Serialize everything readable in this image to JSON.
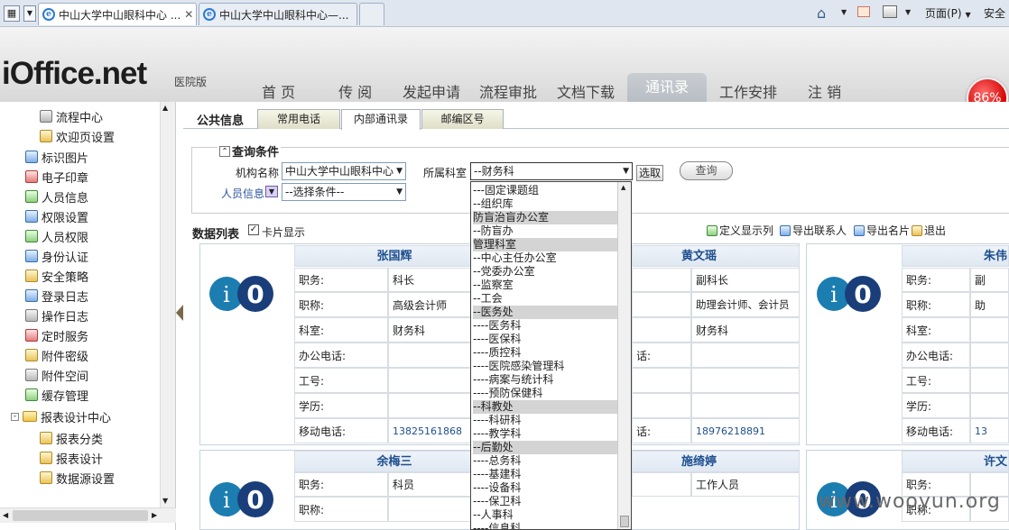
{
  "browser": {
    "tabs": [
      {
        "title": "中山大学中山眼科中心 ...",
        "close": "✕"
      },
      {
        "title": "中山大学中山眼科中心—..."
      }
    ],
    "commands": {
      "page": "页面(P)",
      "safety": "安全"
    },
    "icons": [
      "home-icon",
      "feed-icon",
      "mail-icon",
      "print-icon"
    ]
  },
  "app": {
    "logo": "iOffice.net",
    "edition": "医院版",
    "nav": [
      "首 页",
      "传 阅",
      "发起申请",
      "流程审批",
      "文档下载",
      "通讯录",
      "工作安排",
      "注 销"
    ],
    "active_nav": "通讯录",
    "badge": "86%"
  },
  "sidebar": {
    "items": [
      {
        "label": "流程中心",
        "icon": "doc-icon"
      },
      {
        "label": "欢迎页设置",
        "icon": "gear-icon"
      },
      {
        "label": "标识图片",
        "icon": "image-icon"
      },
      {
        "label": "电子印章",
        "icon": "seal-icon"
      },
      {
        "label": "人员信息",
        "icon": "user-icon"
      },
      {
        "label": "权限设置",
        "icon": "gear-icon"
      },
      {
        "label": "人员权限",
        "icon": "users-icon"
      },
      {
        "label": "身份认证",
        "icon": "id-icon"
      },
      {
        "label": "安全策略",
        "icon": "lock-icon"
      },
      {
        "label": "登录日志",
        "icon": "log-icon"
      },
      {
        "label": "操作日志",
        "icon": "log-icon"
      },
      {
        "label": "定时服务",
        "icon": "clock-icon"
      },
      {
        "label": "附件密级",
        "icon": "key-icon"
      },
      {
        "label": "附件空间",
        "icon": "disk-icon"
      },
      {
        "label": "缓存管理",
        "icon": "cache-icon"
      },
      {
        "label": "报表设计中心",
        "icon": "folder-icon"
      },
      {
        "label": "报表分类",
        "icon": "gear-icon"
      },
      {
        "label": "报表设计",
        "icon": "gear-icon"
      },
      {
        "label": "数据源设置",
        "icon": "gear-icon"
      }
    ]
  },
  "content": {
    "section": "公共信息",
    "tabs": [
      "常用电话",
      "内部通讯录",
      "邮编区号"
    ],
    "active_tab": "内部通讯录",
    "query": {
      "title": "查询条件",
      "org_label": "机构名称",
      "org_value": "中山大学中山眼科中心",
      "dept_label": "所属科室",
      "dept_value": "--财务科",
      "select_button": "选取",
      "person_label": "人员信息",
      "person_value": "--选择条件--",
      "query_button": "查询"
    },
    "list": {
      "title": "数据列表",
      "card_mode": "卡片显示",
      "actions": [
        "定义显示列",
        "导出联系人",
        "导出名片",
        "退出"
      ]
    },
    "dropdown": {
      "options": [
        {
          "text": "---固定课题组",
          "group": false
        },
        {
          "text": "--组织库",
          "group": false
        },
        {
          "text": "防盲治盲办公室",
          "group": true
        },
        {
          "text": "--防盲办",
          "group": false
        },
        {
          "text": "管理科室",
          "group": true
        },
        {
          "text": "--中心主任办公室",
          "group": false
        },
        {
          "text": "--党委办公室",
          "group": false
        },
        {
          "text": "--监察室",
          "group": false
        },
        {
          "text": "--工会",
          "group": false
        },
        {
          "text": "--医务处",
          "group": true
        },
        {
          "text": "----医务科",
          "group": false
        },
        {
          "text": "----医保科",
          "group": false
        },
        {
          "text": "----质控科",
          "group": false
        },
        {
          "text": "----医院感染管理科",
          "group": false
        },
        {
          "text": "----病案与统计科",
          "group": false
        },
        {
          "text": "----预防保健科",
          "group": false
        },
        {
          "text": "--科教处",
          "group": true
        },
        {
          "text": "----科研科",
          "group": false
        },
        {
          "text": "----教学科",
          "group": false
        },
        {
          "text": "--后勤处",
          "group": true
        },
        {
          "text": "----总务科",
          "group": false
        },
        {
          "text": "----基建科",
          "group": false
        },
        {
          "text": "----设备科",
          "group": false
        },
        {
          "text": "----保卫科",
          "group": false
        },
        {
          "text": "--人事科",
          "group": false
        },
        {
          "text": "----信息科",
          "group": false
        }
      ]
    },
    "cards": [
      {
        "name": "张国辉",
        "post": "科长",
        "title": "高级会计师",
        "dept": "财务科",
        "office": "",
        "job_no": "",
        "edu": "",
        "mobile": "13825161868"
      },
      {
        "name": "黄文瑶",
        "post": "副科长",
        "title": "助理会计师、会计员",
        "dept": "财务科",
        "office": "",
        "job_no": "",
        "edu": "",
        "mobile": "18976218891"
      },
      {
        "name": "朱伟",
        "post": "副",
        "title": "助",
        "dept": "",
        "office": "",
        "job_no": "",
        "edu": "",
        "mobile": "13"
      },
      {
        "name": "余梅三",
        "post": "科员",
        "title": "",
        "dept": "",
        "office": "",
        "job_no": "",
        "edu": "",
        "mobile": ""
      },
      {
        "name": "施绮婷",
        "post": "工作人员",
        "title": "",
        "dept": "",
        "office": "",
        "job_no": "",
        "edu": "",
        "mobile": ""
      },
      {
        "name": "许文",
        "post": "",
        "title": "",
        "dept": "",
        "office": "",
        "job_no": "",
        "edu": "",
        "mobile": ""
      }
    ],
    "field_labels": {
      "post": "职务:",
      "title": "职称:",
      "dept": "科室:",
      "office": "办公电话:",
      "job_no": "工号:",
      "edu": "学历:",
      "mobile": "移动电话:"
    },
    "phone_suffix": "话:"
  },
  "watermark": "www.wooyun.org"
}
